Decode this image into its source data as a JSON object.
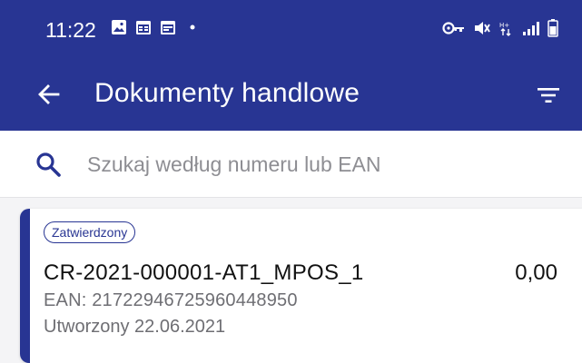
{
  "status_bar": {
    "time": "11:22",
    "left_icons": [
      "gallery-icon",
      "calendar-icon",
      "calendar-icon",
      "dot-icon"
    ],
    "right_icons": [
      "key-icon",
      "mute-icon",
      "hplus-icon",
      "signal-icon",
      "battery-icon"
    ]
  },
  "app_bar": {
    "title": "Dokumenty handlowe",
    "back_icon": "arrow-left-icon",
    "filter_icon": "filter-icon"
  },
  "search": {
    "placeholder": "Szukaj według numeru lub EAN",
    "value": ""
  },
  "documents": [
    {
      "status": "Zatwierdzony",
      "number": "CR-2021-000001-AT1_MPOS_1",
      "amount": "0,00",
      "ean": "EAN: 21722946725960448950",
      "created": "Utworzony 22.06.2021"
    }
  ],
  "colors": {
    "primary": "#283593",
    "background": "#f4f4f6",
    "card": "#ffffff",
    "secondary_text": "#6e6e73"
  }
}
